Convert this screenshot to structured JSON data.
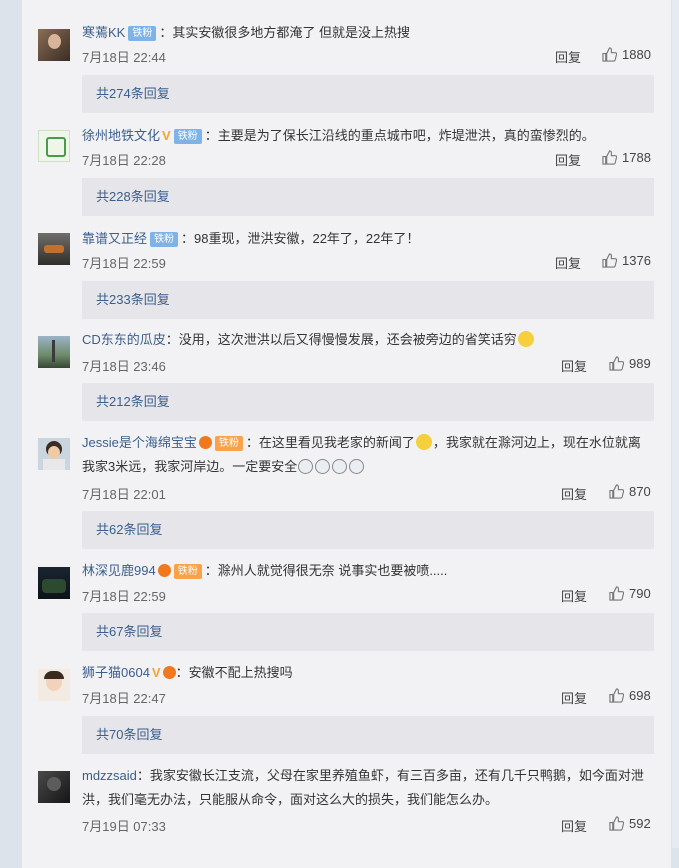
{
  "comments": [
    {
      "user": "寒蔫KK",
      "badge": "铁粉",
      "text": "：其实安徽很多地方都淹了  但就是没上热搜",
      "time": "7月18日 22:44",
      "reply_label": "回复",
      "likes": "1880",
      "replies_label": "共274条回复"
    },
    {
      "user": "徐州地铁文化",
      "badge": "铁粉",
      "text": "：主要是为了保长江沿线的重点城市吧，炸堤泄洪，真的蛮惨烈的。",
      "time": "7月18日 22:28",
      "reply_label": "回复",
      "likes": "1788",
      "replies_label": "共228条回复"
    },
    {
      "user": "靠谱又正经",
      "badge": "铁粉",
      "text": "：98重现，泄洪安徽，22年了，22年了！",
      "time": "7月18日 22:59",
      "reply_label": "回复",
      "likes": "1376",
      "replies_label": "共233条回复"
    },
    {
      "user": "CD东东的瓜皮",
      "text": "：没用，这次泄洪以后又得慢慢发展，还会被旁边的省笑话穷",
      "time": "7月18日 23:46",
      "reply_label": "回复",
      "likes": "989",
      "replies_label": "共212条回复"
    },
    {
      "user": "Jessie是个海绵宝宝",
      "badge": "铁粉",
      "text": "：在这里看见我老家的新闻了",
      "text_cont": "，我家就在滁河边上，现在水位就离",
      "text2": "我家3米远，我家河岸边。一定要安全",
      "time": "7月18日 22:01",
      "reply_label": "回复",
      "likes": "870",
      "replies_label": "共62条回复"
    },
    {
      "user": "林深见鹿994",
      "badge": "铁粉",
      "text": "：滁州人就觉得很无奈 说事实也要被喷.....",
      "time": "7月18日 22:59",
      "reply_label": "回复",
      "likes": "790",
      "replies_label": "共67条回复"
    },
    {
      "user": "狮子猫0604",
      "text": "：安徽不配上热搜吗",
      "time": "7月18日 22:47",
      "reply_label": "回复",
      "likes": "698",
      "replies_label": "共70条回复"
    },
    {
      "user": "mdzzsaid",
      "text": "：我家安徽长江支流，父母在家里养殖鱼虾，有三百多亩，还有几千只鸭鹅，如今面对泄",
      "text2": "洪，我们毫无办法，只能服从命令，面对这么大的损失，我们能怎么办。",
      "time": "7月19日 07:33",
      "reply_label": "回复",
      "likes": "592"
    }
  ],
  "colors": {
    "link": "#3b5e8c",
    "badge": "#7fb3e6",
    "fans_badge": "#f7a34a",
    "replies_bg": "#e6e6ea"
  },
  "icons": [
    "thumbs-up-icon",
    "verified-v-icon",
    "fans-icon",
    "emoji-icon"
  ]
}
